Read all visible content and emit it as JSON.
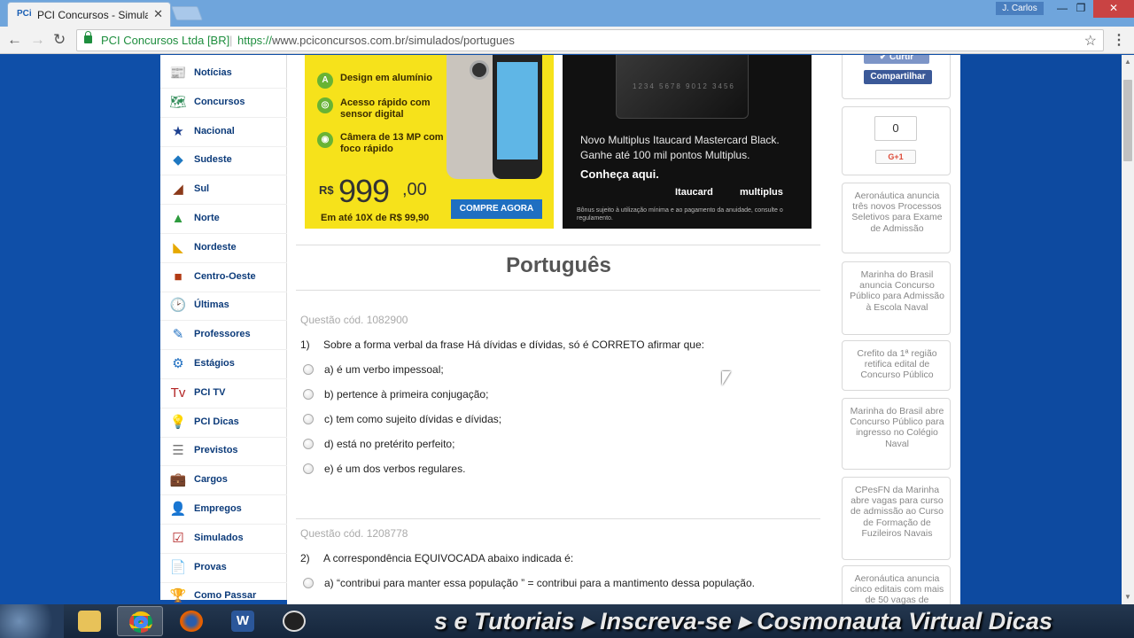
{
  "browser": {
    "tab_favicon": "PCi",
    "tab_title": "PCI Concursos - Simulados",
    "tab_close": "✕",
    "user_badge": "J. Carlos",
    "site_identity": "PCI Concursos Ltda [BR]",
    "url_scheme": "https://",
    "url_rest": "www.pciconcursos.com.br/simulados/portugues",
    "icons": [
      "back-icon",
      "forward-icon",
      "reload-icon",
      "lock-icon",
      "star-icon",
      "menu-icon"
    ]
  },
  "sidebar": {
    "items": [
      {
        "label": "Notícias",
        "icon": "📰"
      },
      {
        "label": "Concursos",
        "icon": "🗺"
      },
      {
        "label": "Nacional",
        "icon": "★"
      },
      {
        "label": "Sudeste",
        "icon": "◆"
      },
      {
        "label": "Sul",
        "icon": "◢"
      },
      {
        "label": "Norte",
        "icon": "▲"
      },
      {
        "label": "Nordeste",
        "icon": "◣"
      },
      {
        "label": "Centro-Oeste",
        "icon": "■"
      },
      {
        "label": "Últimas",
        "icon": "🕑"
      },
      {
        "label": "Professores",
        "icon": "✎"
      },
      {
        "label": "Estágios",
        "icon": "⚙"
      },
      {
        "label": "PCI TV",
        "icon": "Tv"
      },
      {
        "label": "PCI Dicas",
        "icon": "💡"
      },
      {
        "label": "Previstos",
        "icon": "☰"
      },
      {
        "label": "Cargos",
        "icon": "💼"
      },
      {
        "label": "Empregos",
        "icon": "👤"
      },
      {
        "label": "Simulados",
        "icon": "☑"
      },
      {
        "label": "Provas",
        "icon": "📄"
      },
      {
        "label": "Como Passar",
        "icon": "🏆"
      }
    ]
  },
  "ads": {
    "phone": {
      "features": [
        "Design em alumínio",
        "Acesso rápido com sensor digital",
        "Câmera de 13 MP com foco rápido"
      ],
      "price_prefix": "R$",
      "price": "999",
      "price_cents": ",00",
      "installments": "Em até 10X de R$ 99,90",
      "cta": "COMPRE AGORA"
    },
    "card": {
      "card_number": "1234 5678 9012 3456",
      "headline": "Novo Multiplus Itaucard Mastercard Black. Ganhe até 100 mil pontos Multiplus.",
      "cta": "Conheça aqui.",
      "brand1": "Itaucard",
      "brand2": "multiplus",
      "fine_print": "Bônus sujeito à utilização mínima e ao pagamento da anuidade, consulte o regulamento."
    }
  },
  "page_title": "Português",
  "questions": [
    {
      "code": "Questão cód. 1082900",
      "number": "1)",
      "text": "Sobre a forma verbal da frase Há dívidas e dívidas, só é CORRETO afirmar que:",
      "options": [
        "a)  é um verbo impessoal;",
        "b)  pertence à primeira conjugação;",
        "c)  tem como sujeito dívidas e dívidas;",
        "d)  está no pretérito perfeito;",
        "e)  é um dos verbos regulares."
      ]
    },
    {
      "code": "Questão cód. 1208778",
      "number": "2)",
      "text": "A correspondência EQUIVOCADA abaixo indicada é:",
      "options": [
        "a)  “contribui para manter essa população ” = contribui para a mantimento dessa população."
      ]
    }
  ],
  "right_sidebar": {
    "like": "✔ Curtir",
    "share": "Compartilhar",
    "gplus_count": "0",
    "gplus_button": "G+1",
    "news": [
      "Aeronáutica anuncia três novos Processos Seletivos para Exame de Admissão",
      "Marinha do Brasil anuncia Concurso Público para Admissão à Escola Naval",
      "Crefito da 1ª região retifica edital de Concurso Público",
      "Marinha do Brasil abre Concurso Público para ingresso no Colégio Naval",
      "CPesFN da Marinha abre vagas para curso de admissão ao Curso de Formação de Fuzileiros Navais",
      "Aeronáutica anuncia cinco editais com mais de 50 vagas de"
    ]
  },
  "taskbar": {
    "banner": "s e Tutoriais ▸ Inscreva-se ▸ Cosmonauta Virtual Dicas"
  }
}
